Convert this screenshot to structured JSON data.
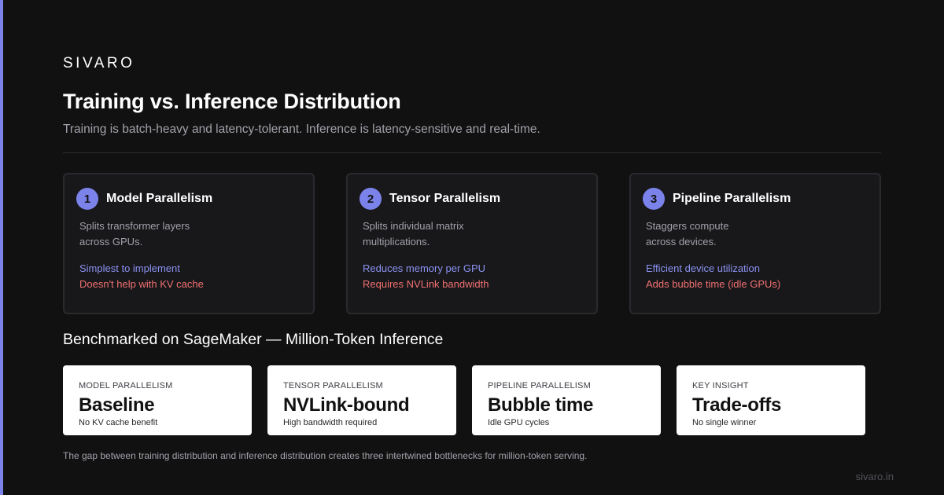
{
  "brand": "SIVARO",
  "title": "Training vs. Inference Distribution",
  "subtitle": "Training is batch-heavy and latency-tolerant. Inference is latency-sensitive and real-time.",
  "cards": [
    {
      "number": "1",
      "title": "Model Parallelism",
      "desc_line1": "Splits transformer layers",
      "desc_line2": "across GPUs.",
      "pro": "Simplest to implement",
      "con": "Doesn't help with KV cache"
    },
    {
      "number": "2",
      "title": "Tensor Parallelism",
      "desc_line1": "Splits individual matrix",
      "desc_line2": "multiplications.",
      "pro": "Reduces memory per GPU",
      "con": "Requires NVLink bandwidth"
    },
    {
      "number": "3",
      "title": "Pipeline Parallelism",
      "desc_line1": "Staggers compute",
      "desc_line2": "across devices.",
      "pro": "Efficient device utilization",
      "con": "Adds bubble time (idle GPUs)"
    }
  ],
  "benchmark_title": "Benchmarked on SageMaker — Million-Token Inference",
  "stats": [
    {
      "label": "MODEL PARALLELISM",
      "value": "Baseline",
      "note": "No KV cache benefit"
    },
    {
      "label": "TENSOR PARALLELISM",
      "value": "NVLink-bound",
      "note": "High bandwidth required"
    },
    {
      "label": "PIPELINE PARALLELISM",
      "value": "Bubble time",
      "note": "Idle GPU cycles"
    },
    {
      "label": "KEY INSIGHT",
      "value": "Trade-offs",
      "note": "No single winner"
    }
  ],
  "footnote": "The gap between training distribution and inference distribution creates three intertwined bottlenecks for million-token serving.",
  "site": "sivaro.in",
  "colors": {
    "accent": "#7b83eb",
    "pro": "#8b92f0",
    "con": "#f07070",
    "background": "#111111"
  }
}
